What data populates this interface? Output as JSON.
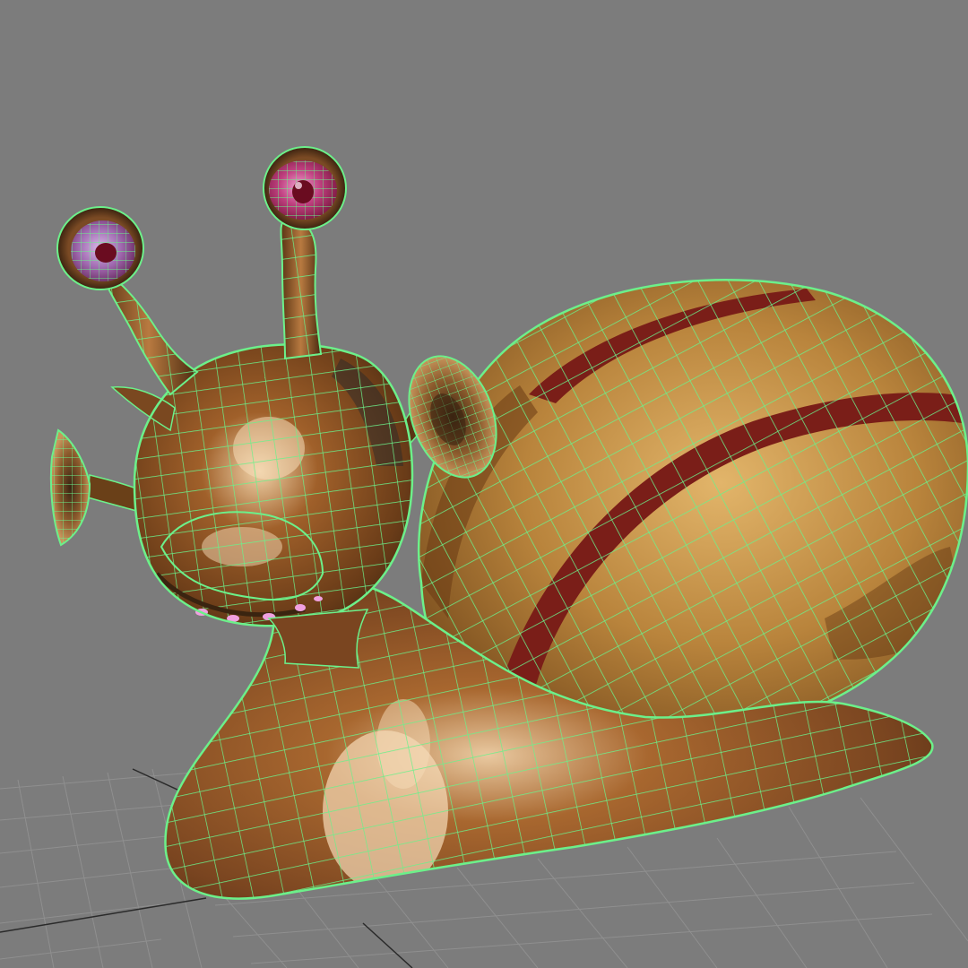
{
  "viewport": {
    "background_color": "#7c7c7c",
    "grid_line_color": "#9a9a9a",
    "grid_axis_color": "#2a2a2a",
    "show_grid": true
  },
  "model": {
    "subject": "snail",
    "display_mode": "wireframe-on-shaded",
    "wireframe_color": "#6cf08a",
    "body_color": "#8a5226",
    "body_highlight_color": "#e8c8a0",
    "shell_color": "#c08a40",
    "shell_stripe_color": "#7a1e18",
    "eye_color": "#b0306a",
    "eye_highlight_color": "#e070b0",
    "pupil_color": "#6a0c20"
  }
}
